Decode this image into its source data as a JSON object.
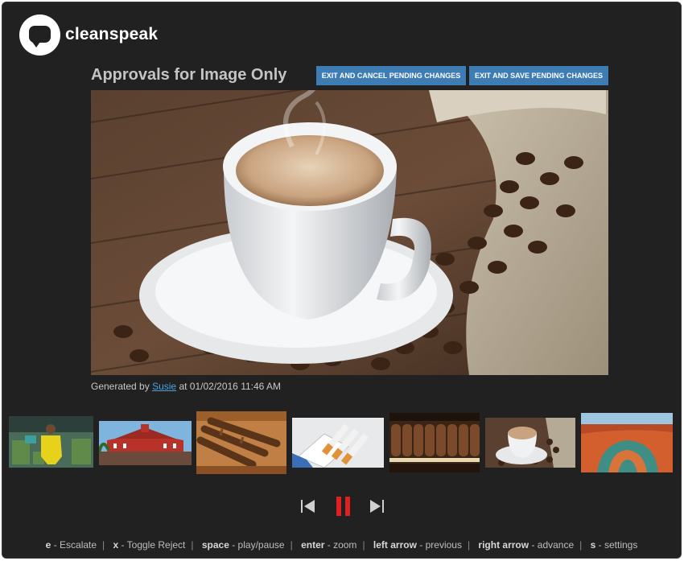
{
  "brand": {
    "name": "cleanspeak"
  },
  "page": {
    "title": "Approvals for Image Only"
  },
  "actions": {
    "cancel_label": "EXIT AND CANCEL PENDING CHANGES",
    "save_label": "EXIT AND SAVE PENDING CHANGES"
  },
  "main_image": {
    "subject": "cup of coffee on saucer with coffee beans and burlap sack",
    "generated_prefix": "Generated by",
    "author": "Susie",
    "timestamp_prefix": "at",
    "timestamp": "01/02/2016 11:46 AM"
  },
  "thumbnails": [
    {
      "subject": "man in yellow suit sitting among stacks of cash"
    },
    {
      "subject": "red colonial building with palm trees"
    },
    {
      "subject": "cigars in a wooden box"
    },
    {
      "subject": "pack of cigarettes"
    },
    {
      "subject": "rows of cigars"
    },
    {
      "subject": "coffee cup with beans (selected)"
    },
    {
      "subject": "canyon river bend landscape"
    }
  ],
  "playback": {
    "prev_icon": "skip-previous-icon",
    "pause_icon": "pause-icon",
    "next_icon": "skip-next-icon",
    "pause_color": "#e02020"
  },
  "shortcuts": [
    {
      "key": "e",
      "action": "- Escalate"
    },
    {
      "key": "x",
      "action": "- Toggle Reject"
    },
    {
      "key": "space",
      "action": "- play/pause"
    },
    {
      "key": "enter",
      "action": "- zoom"
    },
    {
      "key": "left arrow",
      "action": "- previous"
    },
    {
      "key": "right arrow",
      "action": "- advance"
    },
    {
      "key": "s",
      "action": "- settings"
    }
  ],
  "colors": {
    "background": "#212121",
    "button": "#3e7cb4",
    "link": "#4aa3df"
  }
}
